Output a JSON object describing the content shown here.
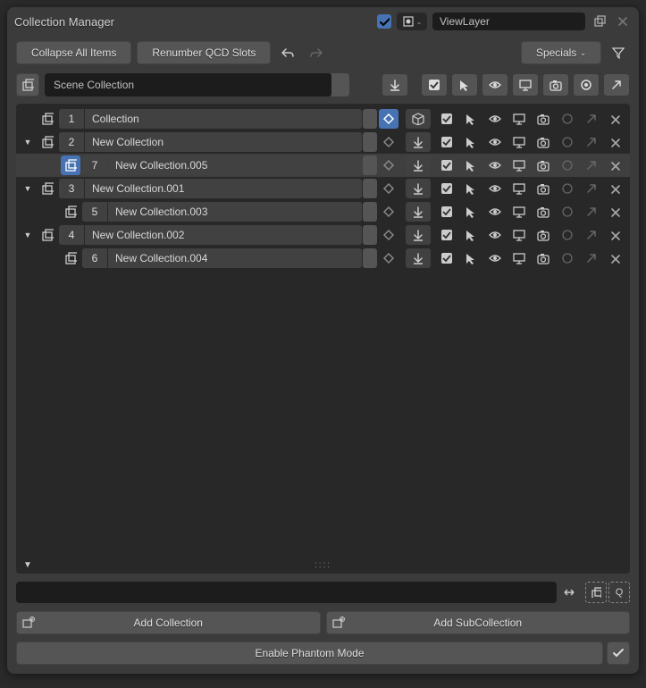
{
  "title": "Collection Manager",
  "viewlayer": "ViewLayer",
  "toolbar": {
    "collapse": "Collapse All Items",
    "renumber": "Renumber QCD Slots",
    "specials": "Specials"
  },
  "scene": "Scene Collection",
  "rows": [
    {
      "slot": "1",
      "name": "Collection",
      "first": true,
      "indent": 0,
      "expand": "",
      "highlighted": false
    },
    {
      "slot": "2",
      "name": "New Collection",
      "first": false,
      "indent": 0,
      "expand": "▼",
      "highlighted": false
    },
    {
      "slot": "7",
      "name": "New Collection.005",
      "first": false,
      "indent": 1,
      "expand": "",
      "highlighted": true
    },
    {
      "slot": "3",
      "name": "New Collection.001",
      "first": false,
      "indent": 0,
      "expand": "▼",
      "highlighted": false
    },
    {
      "slot": "5",
      "name": "New Collection.003",
      "first": false,
      "indent": 1,
      "expand": "",
      "highlighted": false
    },
    {
      "slot": "4",
      "name": "New Collection.002",
      "first": false,
      "indent": 0,
      "expand": "▼",
      "highlighted": false
    },
    {
      "slot": "6",
      "name": "New Collection.004",
      "first": false,
      "indent": 1,
      "expand": "",
      "highlighted": false
    }
  ],
  "bottom": {
    "add": "Add Collection",
    "addsub": "Add SubCollection",
    "phantom": "Enable Phantom Mode"
  }
}
